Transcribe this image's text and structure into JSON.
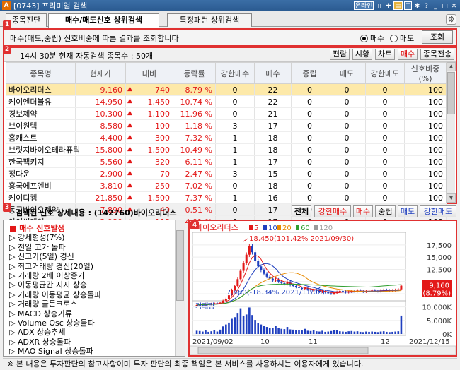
{
  "window": {
    "title": "[0743] 프리미엄 검색",
    "icon_label": "A",
    "buttons": [
      "온라인",
      "T",
      "?",
      "_",
      "✱",
      "□",
      "✕"
    ]
  },
  "tabs": [
    {
      "label": "종목진단",
      "active": false
    },
    {
      "label": "매수/매도신호 상위검색",
      "active": true
    },
    {
      "label": "특정패턴 상위검색",
      "active": false
    }
  ],
  "markers": [
    "1",
    "2",
    "3",
    "4"
  ],
  "panel1": {
    "text": "매수(매도,중립) 신호비중에 따른 결과를 조회합니다",
    "radio_buy": "매수",
    "radio_sell": "매도",
    "selected": "매수",
    "query_button": "조회"
  },
  "panel2": {
    "count_text": "14시 30분 현재 자동검색 종목수 : 50개",
    "buttons": [
      "편람",
      "시황",
      "차트",
      "매수",
      "종목전송"
    ],
    "active_button": "매수",
    "columns": [
      "종목명",
      "현재가",
      "대비",
      "등락률",
      "강한매수",
      "매수",
      "중립",
      "매도",
      "강한매도",
      "신호비중(%)"
    ],
    "rows": [
      [
        "바이오리더스",
        "9,160",
        "740",
        "8.79 %",
        "0",
        "22",
        "0",
        "0",
        "0",
        "100"
      ],
      [
        "케이엔더블유",
        "14,950",
        "1,450",
        "10.74 %",
        "0",
        "22",
        "0",
        "0",
        "0",
        "100"
      ],
      [
        "경보제약",
        "10,300",
        "1,100",
        "11.96 %",
        "0",
        "21",
        "0",
        "0",
        "0",
        "100"
      ],
      [
        "브이원텍",
        "8,580",
        "100",
        "1.18 %",
        "3",
        "17",
        "0",
        "0",
        "0",
        "100"
      ],
      [
        "홈캐스트",
        "4,400",
        "300",
        "7.32 %",
        "1",
        "18",
        "0",
        "0",
        "0",
        "100"
      ],
      [
        "브릿지바이오테라퓨틱",
        "15,800",
        "1,500",
        "10.49 %",
        "1",
        "18",
        "0",
        "0",
        "0",
        "100"
      ],
      [
        "한국팩키지",
        "5,560",
        "320",
        "6.11 %",
        "1",
        "17",
        "0",
        "0",
        "0",
        "100"
      ],
      [
        "정다운",
        "2,900",
        "70",
        "2.47 %",
        "3",
        "15",
        "0",
        "0",
        "0",
        "100"
      ],
      [
        "홍국에프엔비",
        "3,810",
        "250",
        "7.02 %",
        "0",
        "18",
        "0",
        "0",
        "0",
        "100"
      ],
      [
        "케이디켐",
        "21,850",
        "1,500",
        "7.37 %",
        "1",
        "16",
        "0",
        "0",
        "0",
        "100"
      ],
      [
        "동구바이오제약",
        "7,890",
        "40",
        "0.51 %",
        "0",
        "17",
        "0",
        "0",
        "0",
        "100"
      ],
      [
        "아이씨케이",
        "2,980",
        "115",
        "4.01 %",
        "0",
        "17",
        "0",
        "0",
        "0",
        "100"
      ]
    ],
    "selected_row": 0
  },
  "detail": {
    "text": "검색된 신호 상세내용 : (142760)바이오리더스",
    "buttons": [
      "전체",
      "강한매수",
      "매수",
      "중립",
      "매도",
      "강한매도"
    ],
    "button_colors": [
      "#000000",
      "#e31818",
      "#e31818",
      "#000000",
      "#1f3fbf",
      "#1f3fbf"
    ]
  },
  "signals": [
    {
      "text": "■ 매수 신호발생",
      "head": true
    },
    {
      "text": "▷ 강세형성(7%)"
    },
    {
      "text": "▷ 전일 고가 돌파"
    },
    {
      "text": "▷ 신고가(5일) 경신"
    },
    {
      "text": "▷ 최고거래량 경신(20일)"
    },
    {
      "text": "▷ 거래량 2배 이상증가"
    },
    {
      "text": "▷ 이동평균간 지지 상승"
    },
    {
      "text": "▷ 거래량 이동평균 상승돌파"
    },
    {
      "text": "▷ 거래량 골든크로스"
    },
    {
      "text": "▷ MACD 상승기류"
    },
    {
      "text": "▷ Volume Osc 상승돌파"
    },
    {
      "text": "▷ ADX 상승추세"
    },
    {
      "text": "▷ ADXR 상승돌파"
    },
    {
      "text": "▷ MAO Signal 상승돌파"
    }
  ],
  "chart": {
    "stock_name": "바이오리더스",
    "ma_labels": [
      "5",
      "10",
      "20",
      "60",
      "120"
    ],
    "ma_colors": [
      "#e31818",
      "#1f3fbf",
      "#e88a00",
      "#2e9e2e",
      "#9a9a9a"
    ],
    "high_annotation": "18,450(101.42% 2021/09/30)",
    "low_annotation": "7,480(-18.34% 2021/11/08)",
    "price_ticks": [
      "17,500",
      "15,000",
      "12,500",
      "10,000",
      "7,500"
    ],
    "current_price": "9,160",
    "current_change": "(8.79%)",
    "volume_label": "거래량",
    "volume_ticks": [
      "10,000K",
      "5,000K",
      "0K"
    ],
    "date_labels": [
      "2021/09/02",
      "10",
      "11",
      "12",
      "2021/12/15"
    ],
    "colors": {
      "up": "#e31818",
      "down": "#1f3fbf"
    }
  },
  "chart_data": {
    "type": "candlestick",
    "ylim": [
      6500,
      19500
    ],
    "high_point": {
      "date": "2021/09/30",
      "value": 18450
    },
    "low_point": {
      "date": "2021/11/08",
      "value": 7480
    },
    "close_series": [
      5200,
      5300,
      5250,
      5400,
      5350,
      5500,
      5600,
      5550,
      5700,
      6100,
      6500,
      7200,
      8300,
      9100,
      10500,
      12200,
      13800,
      15500,
      17200,
      16000,
      14200,
      13100,
      12300,
      11600,
      11000,
      10600,
      10200,
      10400,
      10000,
      9700,
      9500,
      9900,
      9300,
      9100,
      8900,
      8700,
      8500,
      8700,
      8400,
      8200,
      8300,
      8100,
      7900,
      8000,
      7800,
      7600,
      7500,
      7700,
      7900,
      8100,
      8000,
      7800,
      7900,
      8100,
      8000,
      8200,
      8100,
      7900,
      8000,
      8100,
      8200,
      8100,
      8000,
      8200,
      8300,
      8200,
      8100,
      8200,
      8300,
      8420,
      9160
    ],
    "volume_series": [
      1200,
      1100,
      900,
      1300,
      800,
      1000,
      1400,
      900,
      1600,
      2800,
      3500,
      4200,
      5600,
      6200,
      7800,
      9500,
      6800,
      7200,
      9800,
      7000,
      5200,
      4100,
      3500,
      3000,
      2600,
      2300,
      2200,
      2900,
      2100,
      1900,
      1800,
      2600,
      1700,
      1600,
      1500,
      1400,
      1300,
      1900,
      1200,
      1100,
      1300,
      1000,
      900,
      1200,
      800,
      900,
      1100,
      1500,
      1300,
      1000,
      900,
      800,
      1000,
      1100,
      900,
      1000,
      800,
      700,
      900,
      800,
      900,
      800,
      700,
      900,
      1000,
      800,
      700,
      800,
      900,
      1000,
      6800
    ]
  },
  "status": {
    "text": "※ 본 내용은 투자판단의 참고사항이며 투자 판단의 최종 책임은 본 서비스를 사용하시는 이용자에게 있습니다."
  }
}
